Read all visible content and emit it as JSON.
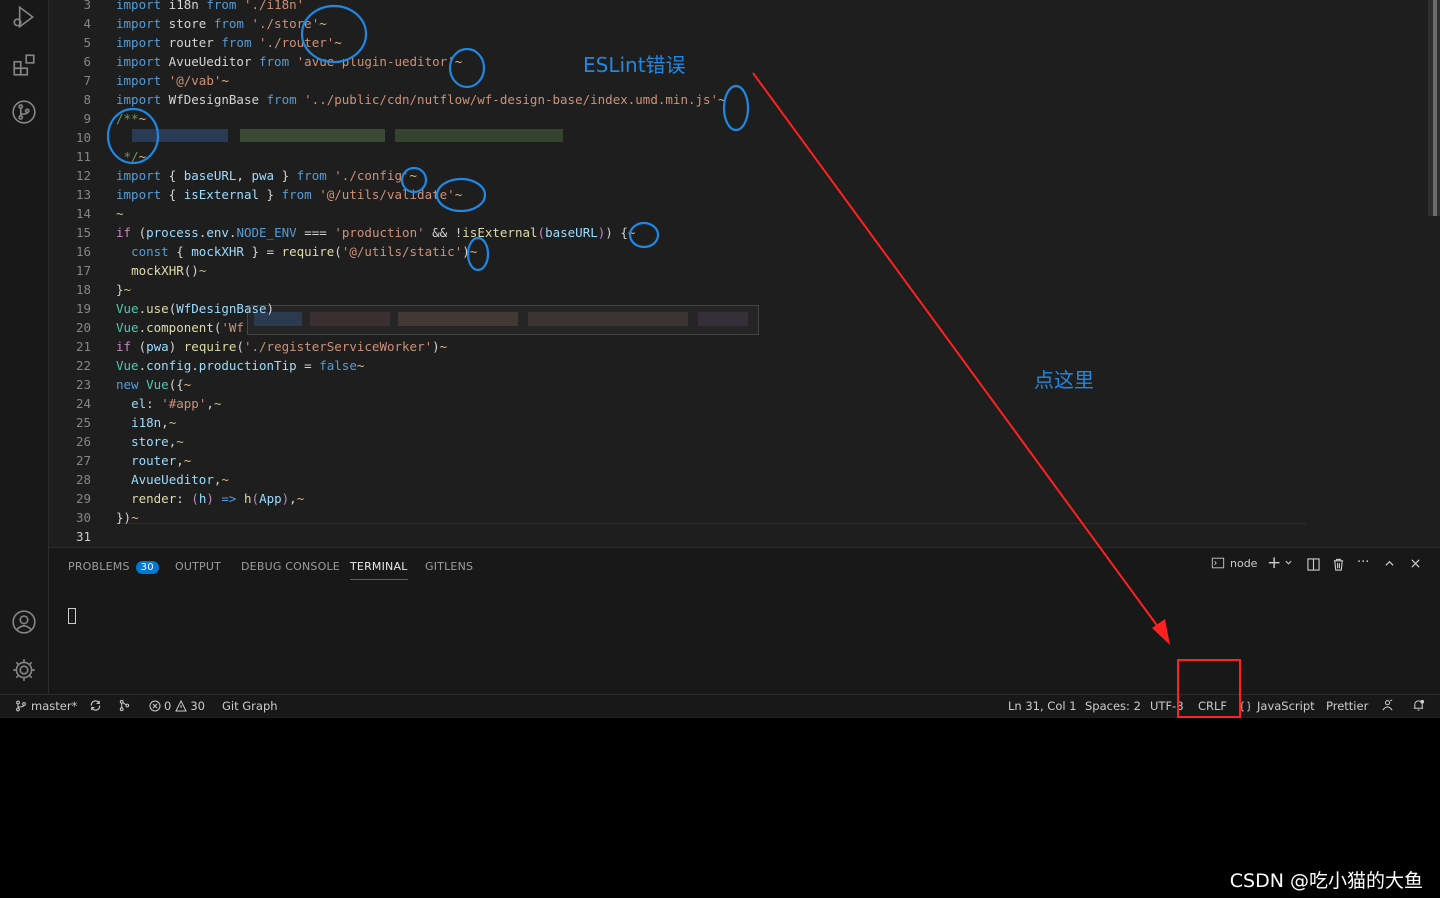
{
  "editor": {
    "lines": [
      {
        "n": "3",
        "segs": [
          [
            "k",
            "import"
          ],
          [
            "p",
            " i18n "
          ],
          [
            "k",
            "from"
          ],
          [
            "p",
            " "
          ],
          [
            "s",
            "'./i18n'"
          ]
        ]
      },
      {
        "n": "4",
        "segs": [
          [
            "k",
            "import"
          ],
          [
            "p",
            " store "
          ],
          [
            "k",
            "from"
          ],
          [
            "p",
            " "
          ],
          [
            "s",
            "'./store'"
          ],
          [
            "sq",
            "~"
          ]
        ]
      },
      {
        "n": "5",
        "segs": [
          [
            "k",
            "import"
          ],
          [
            "p",
            " router "
          ],
          [
            "k",
            "from"
          ],
          [
            "p",
            " "
          ],
          [
            "s",
            "'./router'"
          ],
          [
            "sq",
            "~"
          ]
        ]
      },
      {
        "n": "6",
        "segs": [
          [
            "k",
            "import"
          ],
          [
            "p",
            " AvueUeditor "
          ],
          [
            "k",
            "from"
          ],
          [
            "p",
            " "
          ],
          [
            "s",
            "'avue-plugin-ueditor'"
          ],
          [
            "sq",
            "~"
          ]
        ]
      },
      {
        "n": "7",
        "segs": [
          [
            "k",
            "import"
          ],
          [
            "p",
            " "
          ],
          [
            "s",
            "'@/vab'"
          ],
          [
            "sq",
            "~"
          ]
        ]
      },
      {
        "n": "8",
        "segs": [
          [
            "k",
            "import"
          ],
          [
            "p",
            " WfDesignBase "
          ],
          [
            "k",
            "from"
          ],
          [
            "p",
            " "
          ],
          [
            "s",
            "'../public/cdn/nutflow/wf-design-base/index.umd.min.js'"
          ],
          [
            "sq",
            "~"
          ]
        ]
      },
      {
        "n": "9",
        "segs": [
          [
            "c",
            "/**"
          ],
          [
            "sq",
            "~"
          ]
        ]
      },
      {
        "n": "10",
        "segs": []
      },
      {
        "n": "11",
        "segs": [
          [
            "c",
            " */"
          ],
          [
            "sq",
            "~"
          ]
        ]
      },
      {
        "n": "12",
        "segs": [
          [
            "k",
            "import"
          ],
          [
            "p",
            " { "
          ],
          [
            "v",
            "baseURL"
          ],
          [
            "p",
            ", "
          ],
          [
            "v",
            "pwa"
          ],
          [
            "p",
            " } "
          ],
          [
            "k",
            "from"
          ],
          [
            "p",
            " "
          ],
          [
            "s",
            "'./config'"
          ],
          [
            "sq",
            "~"
          ]
        ]
      },
      {
        "n": "13",
        "segs": [
          [
            "k",
            "import"
          ],
          [
            "p",
            " { "
          ],
          [
            "v",
            "isExternal"
          ],
          [
            "p",
            " } "
          ],
          [
            "k",
            "from"
          ],
          [
            "p",
            " "
          ],
          [
            "s",
            "'@/utils/validate'"
          ],
          [
            "sq",
            "~"
          ]
        ]
      },
      {
        "n": "14",
        "segs": [
          [
            "sq",
            "~"
          ]
        ]
      },
      {
        "n": "15",
        "segs": [
          [
            "kc",
            "if"
          ],
          [
            "p",
            " ("
          ],
          [
            "v",
            "process"
          ],
          [
            "p",
            "."
          ],
          [
            "v",
            "env"
          ],
          [
            "p",
            "."
          ],
          [
            "k",
            "NODE_ENV"
          ],
          [
            "p",
            " === "
          ],
          [
            "s",
            "'production'"
          ],
          [
            "p",
            " && !"
          ],
          [
            "f",
            "isExternal"
          ],
          [
            "kc",
            "("
          ],
          [
            "v",
            "baseURL"
          ],
          [
            "kc",
            ")"
          ],
          [
            "p",
            ") {"
          ],
          [
            "sq",
            "~"
          ]
        ]
      },
      {
        "n": "16",
        "segs": [
          [
            "p",
            "  "
          ],
          [
            "k",
            "const"
          ],
          [
            "p",
            " { "
          ],
          [
            "v",
            "mockXHR"
          ],
          [
            "p",
            " } = "
          ],
          [
            "f",
            "require"
          ],
          [
            "p",
            "("
          ],
          [
            "s",
            "'@/utils/static'"
          ],
          [
            "p",
            ")"
          ],
          [
            "sq",
            "~"
          ]
        ]
      },
      {
        "n": "17",
        "segs": [
          [
            "p",
            "  "
          ],
          [
            "f",
            "mockXHR"
          ],
          [
            "p",
            "()"
          ],
          [
            "sq",
            "~"
          ]
        ]
      },
      {
        "n": "18",
        "segs": [
          [
            "p",
            "}"
          ],
          [
            "sq",
            "~"
          ]
        ]
      },
      {
        "n": "19",
        "segs": [
          [
            "t",
            "Vue"
          ],
          [
            "p",
            "."
          ],
          [
            "f",
            "use"
          ],
          [
            "p",
            "("
          ],
          [
            "v",
            "WfDesignBase"
          ],
          [
            "p",
            ")"
          ]
        ]
      },
      {
        "n": "20",
        "segs": [
          [
            "t",
            "Vue"
          ],
          [
            "p",
            "."
          ],
          [
            "f",
            "component"
          ],
          [
            "p",
            "("
          ],
          [
            "s",
            "'Wf"
          ]
        ]
      },
      {
        "n": "21",
        "segs": [
          [
            "kc",
            "if"
          ],
          [
            "p",
            " ("
          ],
          [
            "v",
            "pwa"
          ],
          [
            "p",
            ") "
          ],
          [
            "f",
            "require"
          ],
          [
            "p",
            "("
          ],
          [
            "s",
            "'./registerServiceWorker'"
          ],
          [
            "p",
            ")"
          ],
          [
            "sq",
            "~"
          ]
        ]
      },
      {
        "n": "22",
        "segs": [
          [
            "t",
            "Vue"
          ],
          [
            "p",
            "."
          ],
          [
            "v",
            "config"
          ],
          [
            "p",
            "."
          ],
          [
            "v",
            "productionTip"
          ],
          [
            "p",
            " = "
          ],
          [
            "k",
            "false"
          ],
          [
            "sq",
            "~"
          ]
        ]
      },
      {
        "n": "23",
        "segs": [
          [
            "k",
            "new"
          ],
          [
            "p",
            " "
          ],
          [
            "t",
            "Vue"
          ],
          [
            "p",
            "({"
          ],
          [
            "sq",
            "~"
          ]
        ]
      },
      {
        "n": "24",
        "segs": [
          [
            "p",
            "  "
          ],
          [
            "v",
            "el"
          ],
          [
            "p",
            ": "
          ],
          [
            "s",
            "'#app'"
          ],
          [
            "p",
            ","
          ],
          [
            "sq",
            "~"
          ]
        ]
      },
      {
        "n": "25",
        "segs": [
          [
            "p",
            "  "
          ],
          [
            "v",
            "i18n"
          ],
          [
            "p",
            ","
          ],
          [
            "sq",
            "~"
          ]
        ]
      },
      {
        "n": "26",
        "segs": [
          [
            "p",
            "  "
          ],
          [
            "v",
            "store"
          ],
          [
            "p",
            ","
          ],
          [
            "sq",
            "~"
          ]
        ]
      },
      {
        "n": "27",
        "segs": [
          [
            "p",
            "  "
          ],
          [
            "v",
            "router"
          ],
          [
            "p",
            ","
          ],
          [
            "sq",
            "~"
          ]
        ]
      },
      {
        "n": "28",
        "segs": [
          [
            "p",
            "  "
          ],
          [
            "v",
            "AvueUeditor"
          ],
          [
            "p",
            ","
          ],
          [
            "sq",
            "~"
          ]
        ]
      },
      {
        "n": "29",
        "segs": [
          [
            "p",
            "  "
          ],
          [
            "f",
            "render"
          ],
          [
            "p",
            ": "
          ],
          [
            "kc",
            "("
          ],
          [
            "v",
            "h"
          ],
          [
            "kc",
            ")"
          ],
          [
            "p",
            " "
          ],
          [
            "k",
            "=>"
          ],
          [
            "p",
            " "
          ],
          [
            "f",
            "h"
          ],
          [
            "kc",
            "("
          ],
          [
            "v",
            "App"
          ],
          [
            "kc",
            ")"
          ],
          [
            "p",
            ","
          ],
          [
            "sq",
            "~"
          ]
        ]
      },
      {
        "n": "30",
        "segs": [
          [
            "p",
            "})"
          ],
          [
            "sq",
            "~"
          ]
        ]
      },
      {
        "n": "31",
        "segs": []
      }
    ]
  },
  "panel": {
    "tabs": [
      "PROBLEMS",
      "OUTPUT",
      "DEBUG CONSOLE",
      "TERMINAL",
      "GITLENS"
    ],
    "problems_count": "30",
    "terminal_label": "node",
    "plus": "+",
    "ellipsis": "···"
  },
  "status": {
    "branch": "master*",
    "errors": "0",
    "warnings": "30",
    "git_graph": "Git Graph",
    "position": "Ln 31, Col 1",
    "spaces": "Spaces: 2",
    "encoding": "UTF-8",
    "eol": "CRLF",
    "language": "JavaScript",
    "formatter": "Prettier"
  },
  "annotations": {
    "eslint_label": "ESLint错误",
    "click_here": "点这里",
    "accent_color": "#1e88e5",
    "arrow_color": "#ff2020"
  },
  "watermark": "CSDN @吃小猫的大鱼"
}
